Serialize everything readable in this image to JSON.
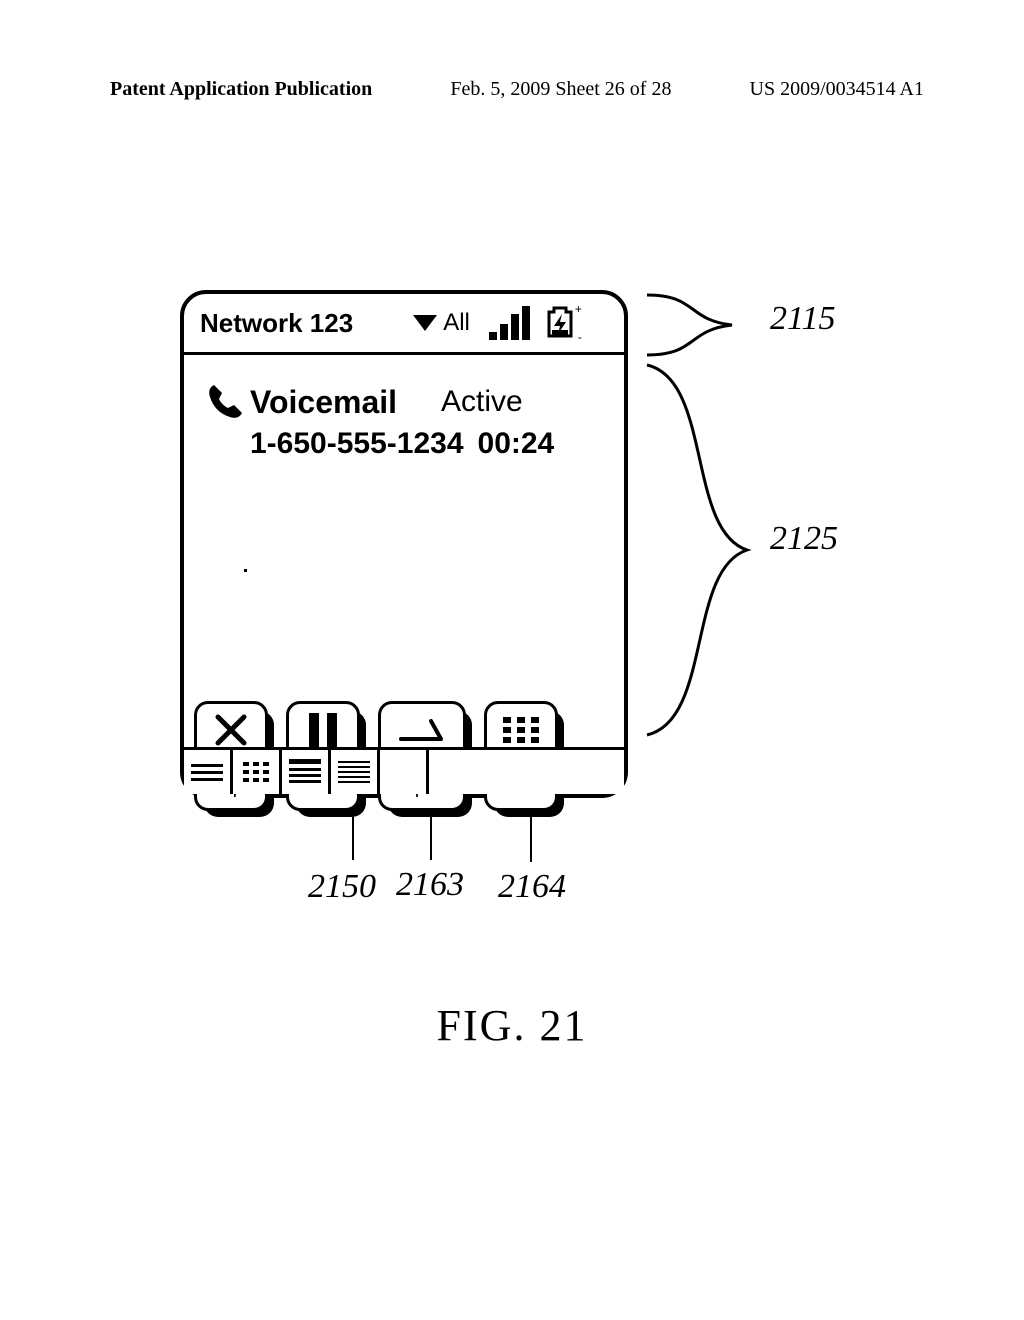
{
  "header": {
    "left": "Patent Application Publication",
    "center": "Feb. 5, 2009  Sheet 26 of 28",
    "right": "US 2009/0034514 A1"
  },
  "statusbar": {
    "network": "Network 123",
    "dropdown_label": "All"
  },
  "call": {
    "title": "Voicemail",
    "status": "Active",
    "number": "1-650-555-1234",
    "duration": "00:24"
  },
  "buttons": {
    "hangup": "Hang\nUp",
    "hold": "Hold",
    "cancel_spkr": "Cancel\nSpkr",
    "keypad": "Key\nPad"
  },
  "refs": {
    "statusbar": "2115",
    "body": "2125",
    "bottom_tab": "2150",
    "cancel_spkr": "2163",
    "keypad": "2164"
  },
  "figure_label": "FIG. 21"
}
